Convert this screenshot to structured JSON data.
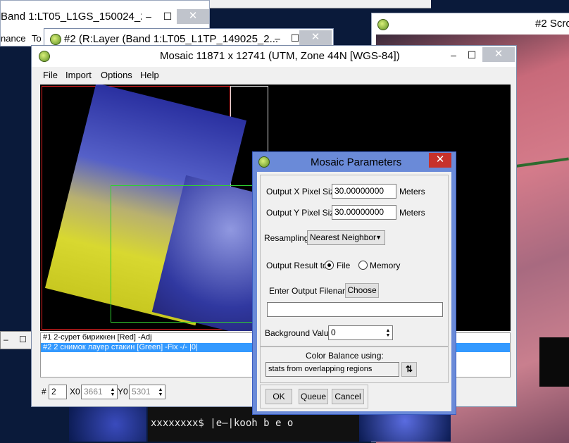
{
  "bg_windows": {
    "band_title": "Band 1:LT05_L1GS_150024_2...",
    "band_menu_1": "nance",
    "band_menu_2": "To",
    "layer_title": "#2 (R:Layer (Band 1:LT05_L1TP_149025_2...",
    "scroll_title": "#2 Scro",
    "min": "–",
    "max": "☐",
    "close": "✕"
  },
  "mosaic": {
    "title": "Mosaic 11871 x 12741 (UTM, Zone 44N [WGS-84])",
    "menu": [
      "File",
      "Import",
      "Options",
      "Help"
    ],
    "layers": [
      "#1 2-сурет бириккен [Red] -Adj",
      "#2 2 снимок лауер стакин [Green] -Fix -/- |0|"
    ],
    "status": {
      "hash_label": "#",
      "index": "2",
      "x0_label": "X0",
      "x0": "3661",
      "y0_label": "Y0",
      "y0": "5301"
    }
  },
  "params": {
    "title": "Mosaic Parameters",
    "out_x_label": "Output X Pixel Size",
    "out_x": "30.00000000",
    "out_y_label": "Output Y Pixel Size",
    "out_y": "30.00000000",
    "meters": "Meters",
    "resampling_label": "Resampling",
    "resampling_value": "Nearest Neighbor",
    "output_label": "Output Result to",
    "file_label": "File",
    "memory_label": "Memory",
    "filename_label": "Enter Output Filename",
    "choose": "Choose",
    "filename_value": "",
    "background_label": "Background Value",
    "background_value": "0",
    "color_balance_label": "Color Balance using:",
    "color_balance_value": "stats from overlapping regions",
    "ok": "OK",
    "queue": "Queue",
    "cancel": "Cancel"
  },
  "bottom_strip_text": "xxxxxxxx$ |е—|kooh b e o"
}
